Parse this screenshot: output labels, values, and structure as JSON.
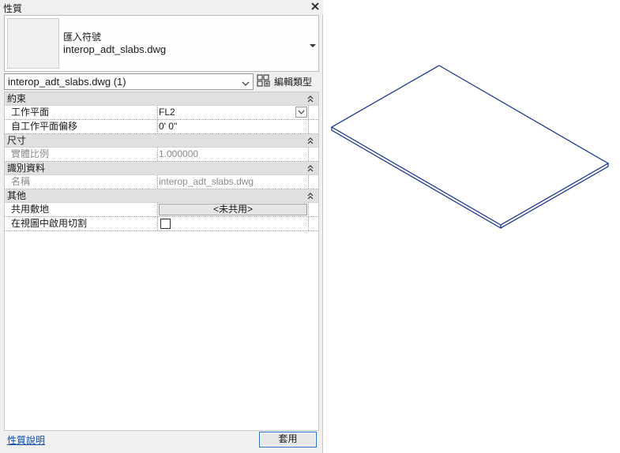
{
  "panel": {
    "title": "性質"
  },
  "type_selector": {
    "line1": "匯入符號",
    "line2": "interop_adt_slabs.dwg"
  },
  "instance": {
    "selected": "interop_adt_slabs.dwg (1)",
    "edit_type_label": "編輯類型"
  },
  "groups": [
    {
      "label": "約束",
      "rows": [
        {
          "name": "工作平面",
          "value": "FL2"
        },
        {
          "name": "自工作平面偏移",
          "value": "0'  0\""
        }
      ]
    },
    {
      "label": "尺寸",
      "rows": [
        {
          "name": "實體比例",
          "value": "1.000000"
        }
      ]
    },
    {
      "label": "識別資料",
      "rows": [
        {
          "name": "名稱",
          "value": "interop_adt_slabs.dwg"
        }
      ]
    },
    {
      "label": "其他",
      "rows": [
        {
          "name": "共用敷地",
          "value": "<未共用>"
        },
        {
          "name": "在視圖中啟用切割",
          "value": ""
        }
      ]
    }
  ],
  "footer": {
    "help_link": "性質說明",
    "apply_label": "套用"
  },
  "colors": {
    "slab_outline": "#1f3a93",
    "apply_border": "#2a6ec9",
    "link": "#0b4db5"
  }
}
